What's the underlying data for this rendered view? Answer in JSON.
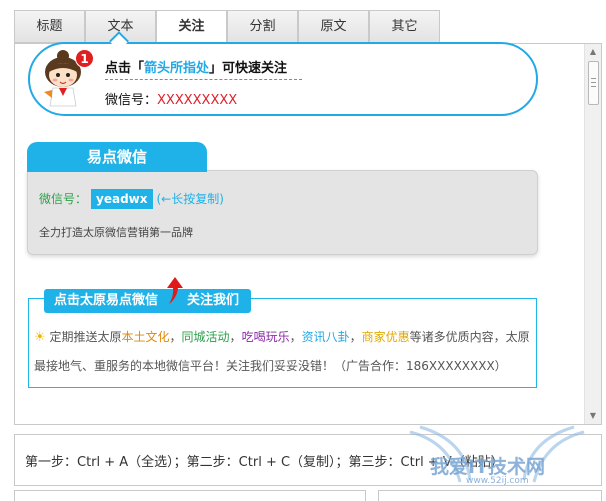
{
  "tabs": [
    {
      "label": "标题",
      "active": false
    },
    {
      "label": "文本",
      "active": false
    },
    {
      "label": "关注",
      "active": true
    },
    {
      "label": "分割",
      "active": false
    },
    {
      "label": "原文",
      "active": false
    },
    {
      "label": "其它",
      "active": false
    }
  ],
  "follow_bubble": {
    "badge": "1",
    "line1_pre": "点击「",
    "line1_link": "箭头所指处",
    "line1_post": "」可快速关注",
    "wechat_label": "微信号：",
    "wechat_id": "XXXXXXXXX"
  },
  "wechat_card": {
    "title": "易点微信",
    "id_label": "微信号：",
    "id_value": "yeadwx",
    "copy_hint": "(←长按复制)",
    "slogan": "全力打造太原微信营销第一品牌"
  },
  "promo_box": {
    "header_left": "点击太原易点微信",
    "header_right": "关注我们",
    "intro": "定期推送太原",
    "tag_culture": "本土文化",
    "sep": "，",
    "tag_events": "同城活动",
    "tag_food": "吃喝玩乐",
    "tag_news": "资讯八卦",
    "tag_deals": "商家优惠",
    "rest": "等诸多优质内容，太原最接地气、重服务的本地微信平台！关注我们妥妥没错！（广告合作：186XXXXXXXX）"
  },
  "steps": {
    "text": "第一步：Ctrl + A（全选）；第二步：Ctrl + C（复制）；第三步：Ctrl + V（粘贴）"
  },
  "watermark": {
    "text": "我爱IT技术网",
    "url": "www.52ij.com"
  },
  "colors": {
    "accent": "#1fb2e8",
    "red": "#e0202a",
    "green": "#2aa24a",
    "orange": "#e28a0a",
    "purple": "#8d2aa6"
  }
}
